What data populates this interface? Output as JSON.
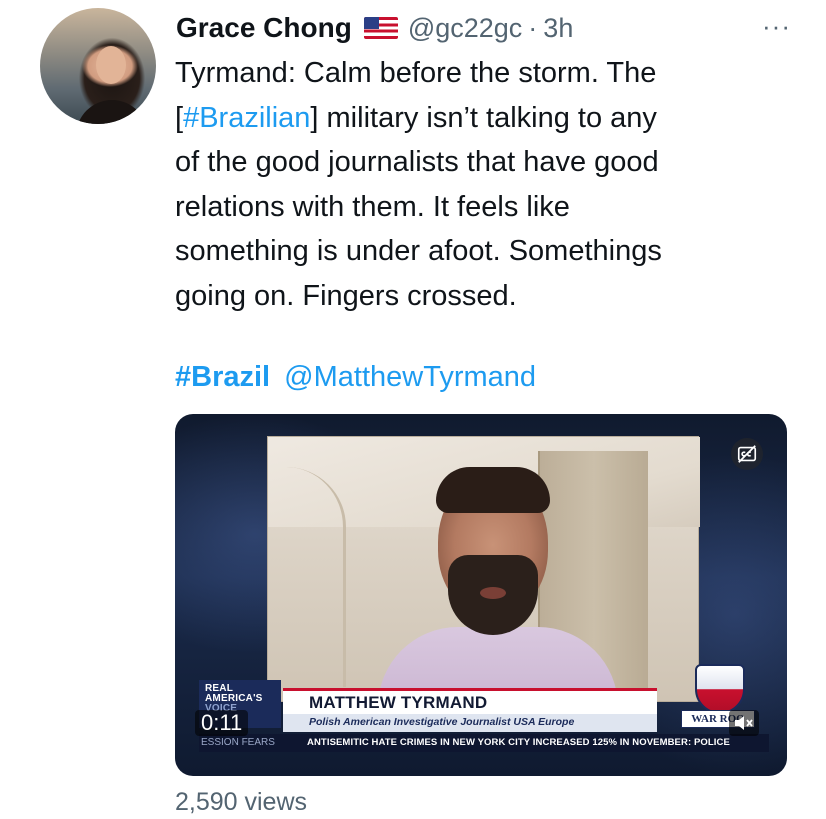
{
  "author": {
    "display_name": "Grace Chong",
    "flag": "us-flag",
    "handle": "@gc22gc",
    "separator": "·",
    "time": "3h"
  },
  "menu": {
    "more_label": "···"
  },
  "tweet": {
    "lines": [
      {
        "pre": "Tyrmand: Calm before the storm. The",
        "link": "",
        "post": ""
      },
      {
        "pre": "[",
        "link": "#Brazilian",
        "post": "] military isn’t talking to any"
      },
      {
        "pre": "of the good journalists that have good",
        "link": "",
        "post": ""
      },
      {
        "pre": "relations with them. It feels like",
        "link": "",
        "post": ""
      },
      {
        "pre": "something is under afoot. Somethings",
        "link": "",
        "post": ""
      },
      {
        "pre": "going on. Fingers crossed.",
        "link": "",
        "post": ""
      }
    ],
    "hashtag": "#Brazil",
    "mention": "@MatthewTyrmand"
  },
  "video": {
    "lower_third": {
      "network_line1": "REAL",
      "network_line2": "AMERICA'S",
      "network_line3": "VOICE",
      "name": "MATTHEW TYRMAND",
      "subtitle": "Polish American Investigative Journalist USA Europe",
      "ticker_left": "ESSION FEARS",
      "ticker": "ANTISEMITIC HATE CRIMES IN NEW YORK CITY INCREASED 125% IN NOVEMBER: POLICE",
      "show_logo": "WAR ROO"
    },
    "elapsed": "0:11",
    "icons": {
      "captions": "closed-captions-off-icon",
      "mute": "muted-speaker-icon"
    }
  },
  "stats": {
    "views": "2,590 views"
  },
  "colors": {
    "link": "#1d9bf0",
    "secondary": "#536471",
    "text": "#0f1419"
  }
}
